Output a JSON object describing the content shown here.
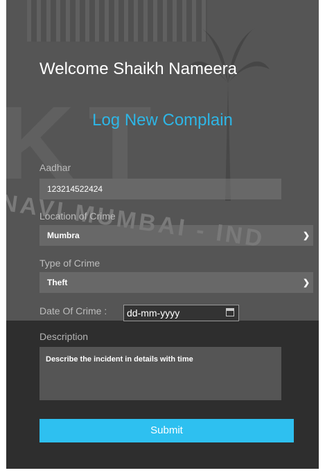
{
  "welcome_text": "Welcome Shaikh Nameera",
  "form_title": "Log New Complain",
  "fields": {
    "aadhar": {
      "label": "Aadhar",
      "value": "123214522424"
    },
    "location": {
      "label": "Location of Crime",
      "value": "Mumbra"
    },
    "type": {
      "label": "Type of Crime",
      "value": "Theft"
    },
    "date": {
      "label": "Date Of Crime :",
      "placeholder": "dd-mm-yyyy"
    },
    "description": {
      "label": "Description",
      "value": "Describe the incident in details with time"
    }
  },
  "submit_label": "Submit",
  "background_watermark": {
    "letters": "KT",
    "arc_text": "NAVI MUMBAI - IND"
  },
  "colors": {
    "accent": "#2ec0f0",
    "heading": "#2eb6e6",
    "panel": "#2e2e2e"
  }
}
